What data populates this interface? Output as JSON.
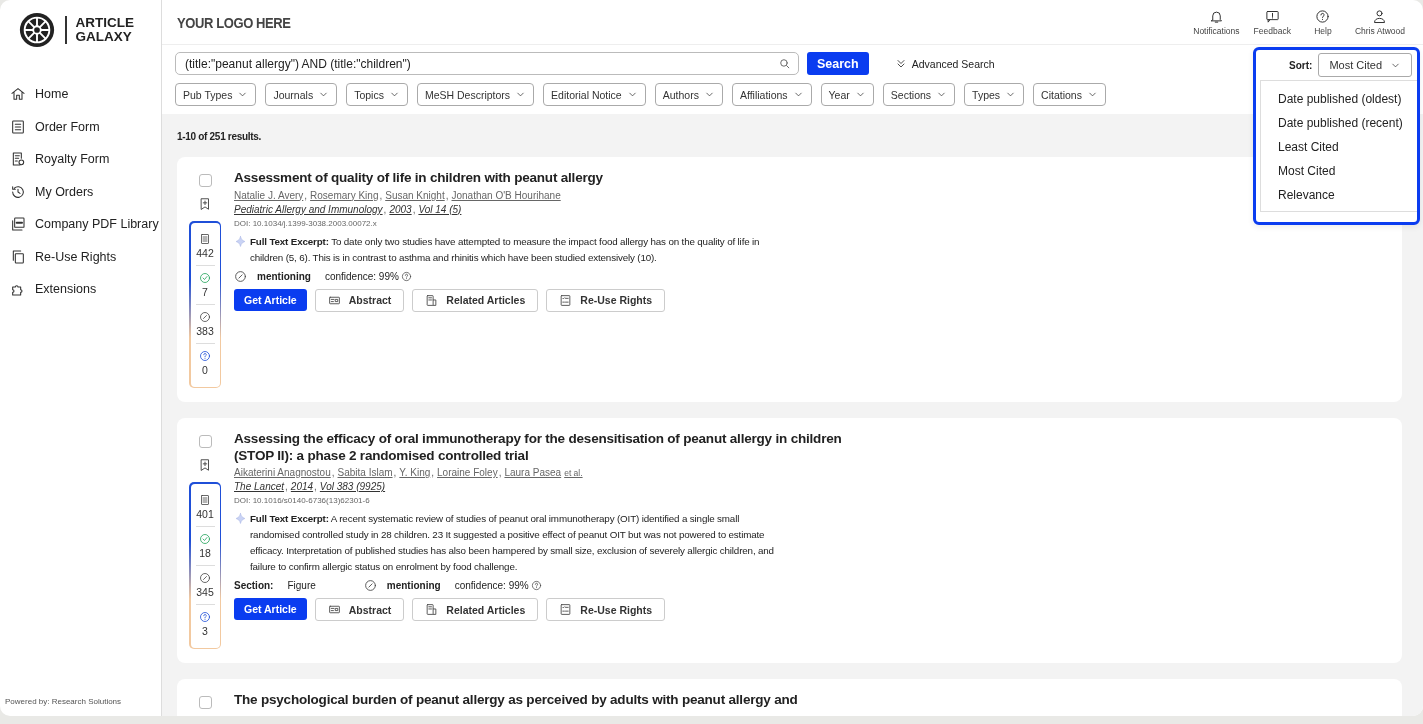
{
  "sidebar": {
    "logo": {
      "line1": "ARTICLE",
      "line2": "GALAXY"
    },
    "items": [
      {
        "label": "Home"
      },
      {
        "label": "Order Form"
      },
      {
        "label": "Royalty Form"
      },
      {
        "label": "My Orders"
      },
      {
        "label": "Company PDF Library"
      },
      {
        "label": "Re-Use Rights"
      },
      {
        "label": "Extensions"
      }
    ],
    "footer": "Powered by: Research Solutions"
  },
  "header": {
    "brand": "YOUR LOGO HERE",
    "actions": [
      {
        "label": "Notifications"
      },
      {
        "label": "Feedback"
      },
      {
        "label": "Help"
      },
      {
        "label": "Chris Atwood"
      }
    ]
  },
  "search": {
    "value": "(title:\"peanut allergy\") AND (title:\"children\")",
    "button": "Search",
    "advanced": "Advanced Search"
  },
  "filters": [
    "Pub Types",
    "Journals",
    "Topics",
    "MeSH Descriptors",
    "Editorial Notice",
    "Authors",
    "Affiliations",
    "Year",
    "Sections",
    "Types",
    "Citations"
  ],
  "sort": {
    "label": "Sort:",
    "value": "Most Cited",
    "options": [
      "Date published (oldest)",
      "Date published (recent)",
      "Least Cited",
      "Most Cited",
      "Relevance"
    ]
  },
  "results_count": "1-10 of 251 results.",
  "list_separator": ",",
  "articles": [
    {
      "checked": false,
      "title": "Assessment of quality of life in children with peanut allergy",
      "authors": [
        "Natalie J. Avery",
        "Rosemary King",
        "Susan Knight",
        "Jonathan O'B Hourihane"
      ],
      "citation": [
        "Pediatric Allergy and Immunology",
        "2003",
        "Vol 14 (5)"
      ],
      "doi": "DOI: 10.1034/j.1399-3038.2003.00072.x",
      "excerpt": "**Full Text Excerpt:**  To date only two studies have attempted to measure the impact food allergy has on the quality of life in children (5, 6). This is in contrast to asthma and rhinitis which have been studied extensively (10).",
      "classification": "mentioning",
      "confidence": "confidence: 99%",
      "counts": [
        {
          "kind": "publications",
          "value": "442"
        },
        {
          "kind": "supporting",
          "value": "7"
        },
        {
          "kind": "mentioning",
          "value": "383"
        },
        {
          "kind": "unclassified",
          "value": "0"
        }
      ],
      "buttons": [
        {
          "kind": "primary",
          "label": "Get Article"
        },
        {
          "kind": "abstract",
          "label": "Abstract"
        },
        {
          "kind": "related",
          "label": "Related Articles"
        },
        {
          "kind": "rights",
          "label": "Re-Use Rights"
        }
      ]
    },
    {
      "checked": false,
      "title": "Assessing the efficacy of oral immunotherapy for the desensitisation of peanut allergy in children (STOP II): a phase 2 randomised controlled trial",
      "authors": [
        "Aikaterini Anagnostou",
        "Sabita Islam",
        "Y. King",
        "Loraine Foley",
        "Laura Pasea"
      ],
      "et_al": "et al.",
      "citation": [
        "The Lancet",
        "2014",
        "Vol 383 (9925)"
      ],
      "doi": "DOI: 10.1016/s0140-6736(13)62301-6",
      "excerpt": "**Full Text Excerpt:**  A recent systematic review of studies of peanut oral immunotherapy (OIT) identified a single small randomised controlled study in 28 children. 23 It suggested a positive effect of peanut OIT but was not powered to estimate efficacy. Interpretation of published studies has also been hampered by small size, exclusion of severely allergic children, and failure to confirm allergic status on enrolment by food challenge.",
      "section_label": "Section:",
      "section": "Figure",
      "classification": "mentioning",
      "confidence": "confidence: 99%",
      "counts": [
        {
          "kind": "publications",
          "value": "401"
        },
        {
          "kind": "supporting",
          "value": "18"
        },
        {
          "kind": "mentioning",
          "value": "345"
        },
        {
          "kind": "unclassified",
          "value": "3"
        }
      ],
      "buttons": [
        {
          "kind": "primary",
          "label": "Get Article"
        },
        {
          "kind": "abstract",
          "label": "Abstract"
        },
        {
          "kind": "related",
          "label": "Related Articles"
        },
        {
          "kind": "rights",
          "label": "Re-Use Rights"
        }
      ]
    },
    {
      "checked": false,
      "title": "The psychological burden of peanut allergy as perceived by adults with peanut allergy and"
    }
  ]
}
